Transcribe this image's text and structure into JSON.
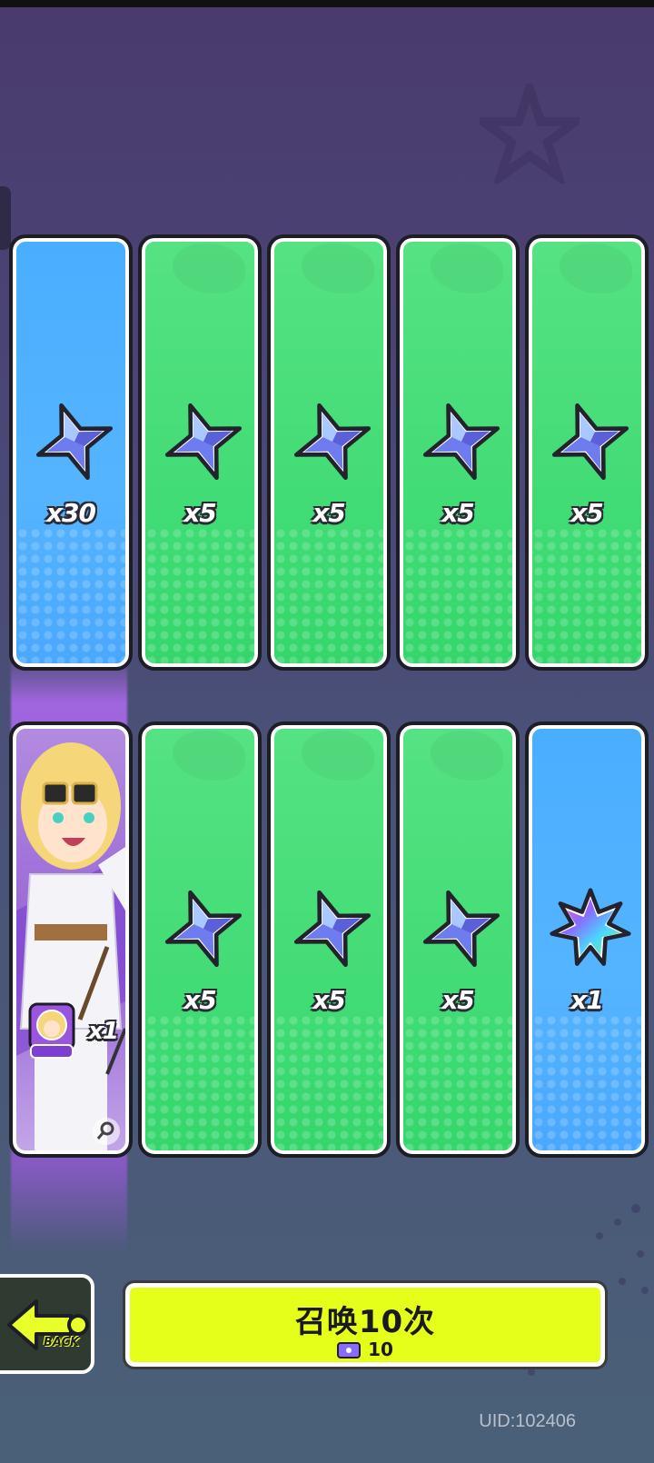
{
  "rewards_row1": [
    {
      "count": "x30",
      "type": "star-gem",
      "rarity_color": "#4aaeff"
    },
    {
      "count": "x5",
      "type": "star-gem",
      "rarity_color": "#3fdb74"
    },
    {
      "count": "x5",
      "type": "star-gem",
      "rarity_color": "#3fdb74"
    },
    {
      "count": "x5",
      "type": "star-gem",
      "rarity_color": "#3fdb74"
    },
    {
      "count": "x5",
      "type": "star-gem",
      "rarity_color": "#3fdb74"
    }
  ],
  "rewards_row2": [
    {
      "count": "x1",
      "type": "character-card",
      "rarity_color": "#9763d6"
    },
    {
      "count": "x5",
      "type": "star-gem",
      "rarity_color": "#3fdb74"
    },
    {
      "count": "x5",
      "type": "star-gem",
      "rarity_color": "#3fdb74"
    },
    {
      "count": "x5",
      "type": "star-gem",
      "rarity_color": "#3fdb74"
    },
    {
      "count": "x1",
      "type": "rainbow-gem",
      "rarity_color": "#4aaeff"
    }
  ],
  "back_button": {
    "label": "BACK"
  },
  "summon_button": {
    "label": "召唤10次",
    "cost": "10",
    "cost_icon": "ticket-icon"
  },
  "uid": "UID:102406"
}
